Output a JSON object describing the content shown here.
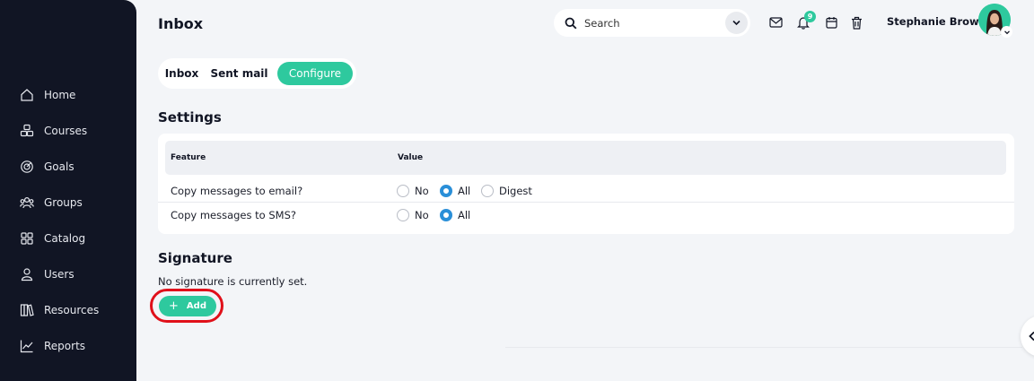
{
  "page": {
    "title": "Inbox"
  },
  "sidebar": {
    "items": [
      {
        "label": "Home",
        "icon": "home-icon"
      },
      {
        "label": "Courses",
        "icon": "courses-icon"
      },
      {
        "label": "Goals",
        "icon": "target-icon"
      },
      {
        "label": "Groups",
        "icon": "groups-icon"
      },
      {
        "label": "Catalog",
        "icon": "grid-icon"
      },
      {
        "label": "Users",
        "icon": "user-icon"
      },
      {
        "label": "Resources",
        "icon": "books-icon"
      },
      {
        "label": "Reports",
        "icon": "chart-icon"
      }
    ]
  },
  "header": {
    "search_placeholder": "Search",
    "notification_count": "9",
    "user_name": "Stephanie Brown"
  },
  "tabs": [
    {
      "label": "Inbox",
      "active": false
    },
    {
      "label": "Sent mail",
      "active": false
    },
    {
      "label": "Configure",
      "active": true
    }
  ],
  "settings": {
    "title": "Settings",
    "columns": [
      "Feature",
      "Value"
    ],
    "rows": [
      {
        "feature": "Copy messages to email?",
        "options": [
          "No",
          "All",
          "Digest"
        ],
        "selected": "All"
      },
      {
        "feature": "Copy messages to SMS?",
        "options": [
          "No",
          "All"
        ],
        "selected": "All"
      }
    ]
  },
  "signature": {
    "title": "Signature",
    "status": "No signature is currently set.",
    "add_label": "Add"
  },
  "colors": {
    "sidebar_bg": "#111524",
    "accent": "#2ec99e",
    "radio_selected": "#2a8fd8",
    "highlight": "#e0101a"
  }
}
